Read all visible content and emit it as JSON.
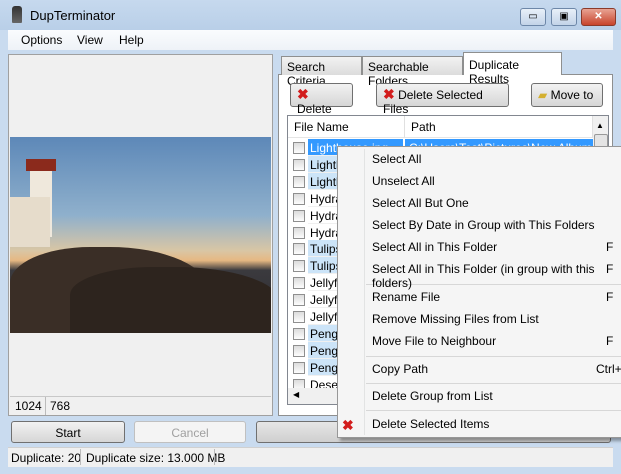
{
  "window": {
    "title": "DupTerminator",
    "minimize": "▭",
    "maximize": "▣",
    "close": "✕"
  },
  "menu": [
    "Options",
    "View",
    "Help"
  ],
  "preview": {
    "width": "1024",
    "height": "768"
  },
  "tabs": [
    "Search Criteria",
    "Searchable Folders",
    "Duplicate Results"
  ],
  "toolbar": {
    "delete": "Delete",
    "delete_selected": "Delete Selected Files",
    "move_to": "Move to"
  },
  "list": {
    "headers": [
      "File Name",
      "Path"
    ],
    "rows": [
      {
        "name": "Lighthouse.jpg",
        "path": "C:\\Users\\Test\\Pictures\\New Album"
      },
      {
        "name": "Lighth"
      },
      {
        "name": "Lighth"
      },
      {
        "name": "Hydra"
      },
      {
        "name": "Hydra"
      },
      {
        "name": "Hydra"
      },
      {
        "name": "Tulips"
      },
      {
        "name": "Tulips"
      },
      {
        "name": "Jellyfis"
      },
      {
        "name": "Jellyfis"
      },
      {
        "name": "Jellyfis"
      },
      {
        "name": "Pengu"
      },
      {
        "name": "Pengu"
      },
      {
        "name": "Pengu"
      },
      {
        "name": "Deser"
      }
    ]
  },
  "buttons": {
    "start": "Start",
    "cancel": "Cancel"
  },
  "status": {
    "duplicate": "Duplicate: 20",
    "size": "Duplicate size: 13.000 MB"
  },
  "context_menu": [
    {
      "label": "Select All"
    },
    {
      "label": "Unselect All"
    },
    {
      "label": "Select All But One"
    },
    {
      "label": "Select By Date in Group with This Folders"
    },
    {
      "label": "Select All in This Folder",
      "shortcut": "F"
    },
    {
      "label": "Select All in This Folder (in group with this folders)",
      "shortcut": "F"
    },
    {
      "label": "Rename File",
      "shortcut": "F"
    },
    {
      "label": "Remove Missing Files from List"
    },
    {
      "label": "Move File to Neighbour",
      "shortcut": "F"
    },
    {
      "label": "Copy Path",
      "shortcut": "Ctrl+"
    },
    {
      "label": "Delete Group from List"
    },
    {
      "label": "Delete Selected Items"
    }
  ]
}
